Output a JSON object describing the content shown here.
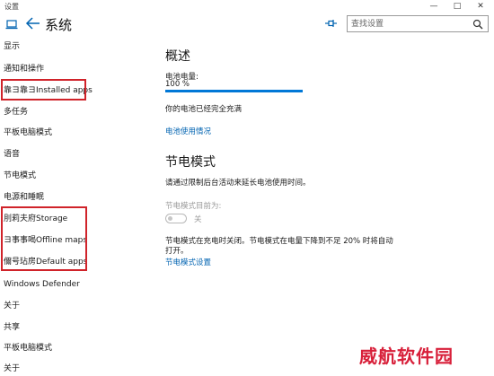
{
  "window": {
    "title": "设置",
    "minimize": "—",
    "maximize": "□",
    "close": "✕"
  },
  "header": {
    "title": "系统",
    "search_placeholder": "查找设置"
  },
  "sidebar": {
    "items": [
      {
        "label": "显示"
      },
      {
        "label": "通知和操作"
      },
      {
        "label": "靠ヨ靠ヨInstalled apps"
      },
      {
        "label": "多任务"
      },
      {
        "label": "平板电脑模式"
      },
      {
        "label": "语音"
      },
      {
        "label": "节电模式"
      },
      {
        "label": "电源和睡眠"
      },
      {
        "label": "刖莉夫府Storage"
      },
      {
        "label": "ヨ事事喝Offline maps"
      },
      {
        "label": "儞号玷房Default apps"
      },
      {
        "label": "Windows Defender"
      },
      {
        "label": "关于"
      },
      {
        "label": "共享"
      },
      {
        "label": "平板电脑模式"
      },
      {
        "label": "关于"
      }
    ]
  },
  "overview": {
    "heading": "概述",
    "battery_label": "电池电量:",
    "battery_percent": "100 %",
    "battery_level": 1.0,
    "battery_status": "你的电池已经完全充满",
    "usage_link": "电池使用情况"
  },
  "saver": {
    "heading": "节电模式",
    "description": "请通过限制后台活动来延长电池使用时间。",
    "toggle_caption": "节电模式目前为:",
    "toggle_state": "关",
    "toggle_on": false,
    "note_line1": "节电模式在充电时关闭。节电模式在电量下降到不足 20% 时将自动",
    "note_line2": "打开。",
    "settings_link": "节电模式设置"
  },
  "colors": {
    "accent": "#0078d7",
    "link": "#0063b1",
    "highlight": "#d0232a"
  },
  "watermark": "威航软件园"
}
